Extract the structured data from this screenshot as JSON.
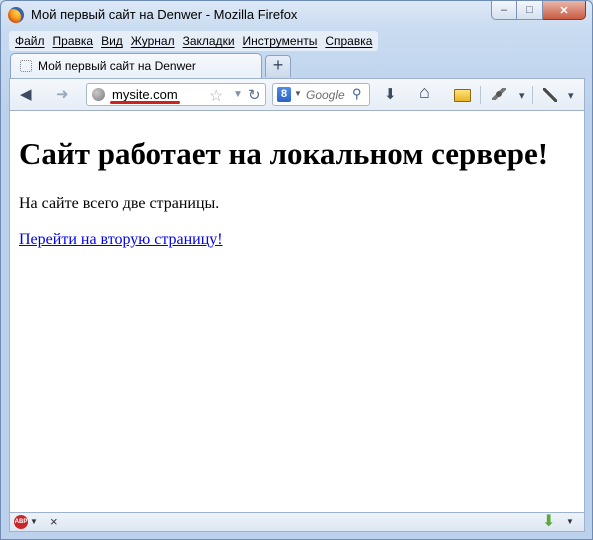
{
  "window": {
    "title": "Мой первый сайт на Denwer - Mozilla Firefox",
    "controls": {
      "minimize": "–",
      "maximize": "□",
      "close": "✕"
    }
  },
  "menubar": {
    "items": [
      {
        "label": "Файл"
      },
      {
        "label": "Правка"
      },
      {
        "label": "Вид"
      },
      {
        "label": "Журнал"
      },
      {
        "label": "Закладки"
      },
      {
        "label": "Инструменты"
      },
      {
        "label": "Справка"
      }
    ]
  },
  "tabs": {
    "active": {
      "label": "Мой первый сайт на Denwer"
    },
    "new_tab_label": "+"
  },
  "navbar": {
    "url": "mysite.com",
    "search": {
      "engine_badge": "8",
      "placeholder": "Google"
    },
    "icons": {
      "back": "back-arrow-icon",
      "forward": "forward-arrow-icon",
      "bookmark_star": "star-icon",
      "reload": "reload-icon",
      "downloads": "download-icon",
      "home": "home-icon",
      "extension": "extension-icon",
      "dev": "dev-tools-icon"
    },
    "glyphs": {
      "back": "◀",
      "forward": "➜",
      "star": "☆",
      "small_drop": "▼",
      "reload": "↻",
      "search_drop": "▼",
      "search_glass": "⚲",
      "download": "⬇",
      "home": "⌂",
      "menu_drop": "▾"
    }
  },
  "page": {
    "heading": "Сайт работает на локальном сервере!",
    "paragraph": "На сайте всего две страницы.",
    "link": "Перейти на вторую страницу!"
  },
  "statusbar": {
    "abp_label": "ABP",
    "abp_drop": "▼",
    "close_glyph": "×",
    "download_glyph": "⬇",
    "download_drop": "▼"
  },
  "colors": {
    "link": "#0000ee",
    "url_underline": "#d02020",
    "window_frame": "#c8dbf0"
  }
}
